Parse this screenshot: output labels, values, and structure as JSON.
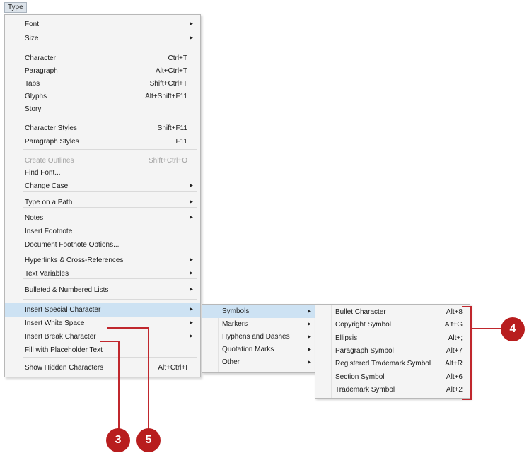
{
  "menubar": {
    "type_label": "Type"
  },
  "type_menu": {
    "items": [
      {
        "label": "Font",
        "shortcut": "",
        "submenu": true
      },
      {
        "label": "Size",
        "shortcut": "",
        "submenu": true
      },
      {
        "label": "Character",
        "shortcut": "Ctrl+T",
        "submenu": false
      },
      {
        "label": "Paragraph",
        "shortcut": "Alt+Ctrl+T",
        "submenu": false
      },
      {
        "label": "Tabs",
        "shortcut": "Shift+Ctrl+T",
        "submenu": false
      },
      {
        "label": "Glyphs",
        "shortcut": "Alt+Shift+F11",
        "submenu": false
      },
      {
        "label": "Story",
        "shortcut": "",
        "submenu": false
      },
      {
        "label": "Character Styles",
        "shortcut": "Shift+F11",
        "submenu": false
      },
      {
        "label": "Paragraph Styles",
        "shortcut": "F11",
        "submenu": false
      },
      {
        "label": "Create Outlines",
        "shortcut": "Shift+Ctrl+O",
        "submenu": false,
        "disabled": true
      },
      {
        "label": "Find Font...",
        "shortcut": "",
        "submenu": false
      },
      {
        "label": "Change Case",
        "shortcut": "",
        "submenu": true
      },
      {
        "label": "Type on a Path",
        "shortcut": "",
        "submenu": true
      },
      {
        "label": "Notes",
        "shortcut": "",
        "submenu": true
      },
      {
        "label": "Insert Footnote",
        "shortcut": "",
        "submenu": false
      },
      {
        "label": "Document Footnote Options...",
        "shortcut": "",
        "submenu": false
      },
      {
        "label": "Hyperlinks & Cross-References",
        "shortcut": "",
        "submenu": true
      },
      {
        "label": "Text Variables",
        "shortcut": "",
        "submenu": true
      },
      {
        "label": "Bulleted & Numbered Lists",
        "shortcut": "",
        "submenu": true
      },
      {
        "label": "Insert Special Character",
        "shortcut": "",
        "submenu": true,
        "highlighted": true
      },
      {
        "label": "Insert White Space",
        "shortcut": "",
        "submenu": true
      },
      {
        "label": "Insert Break Character",
        "shortcut": "",
        "submenu": true
      },
      {
        "label": "Fill with Placeholder Text",
        "shortcut": "",
        "submenu": false
      },
      {
        "label": "Show Hidden Characters",
        "shortcut": "Alt+Ctrl+I",
        "submenu": false
      }
    ]
  },
  "special_char_menu": {
    "items": [
      {
        "label": "Symbols",
        "submenu": true,
        "highlighted": true
      },
      {
        "label": "Markers",
        "submenu": true
      },
      {
        "label": "Hyphens and Dashes",
        "submenu": true
      },
      {
        "label": "Quotation Marks",
        "submenu": true
      },
      {
        "label": "Other",
        "submenu": true
      }
    ]
  },
  "symbols_menu": {
    "items": [
      {
        "label": "Bullet Character",
        "shortcut": "Alt+8"
      },
      {
        "label": "Copyright Symbol",
        "shortcut": "Alt+G"
      },
      {
        "label": "Ellipsis",
        "shortcut": "Alt+;"
      },
      {
        "label": "Paragraph Symbol",
        "shortcut": "Alt+7"
      },
      {
        "label": "Registered Trademark Symbol",
        "shortcut": "Alt+R"
      },
      {
        "label": "Section Symbol",
        "shortcut": "Alt+6"
      },
      {
        "label": "Trademark Symbol",
        "shortcut": "Alt+2"
      }
    ]
  },
  "callouts": {
    "c3": "3",
    "c4": "4",
    "c5": "5"
  },
  "colors": {
    "callout": "#b81d1e",
    "highlight": "#cde2f3",
    "menu_bg": "#f4f4f4"
  },
  "icons": {
    "submenu_arrow": "triangle-right"
  }
}
